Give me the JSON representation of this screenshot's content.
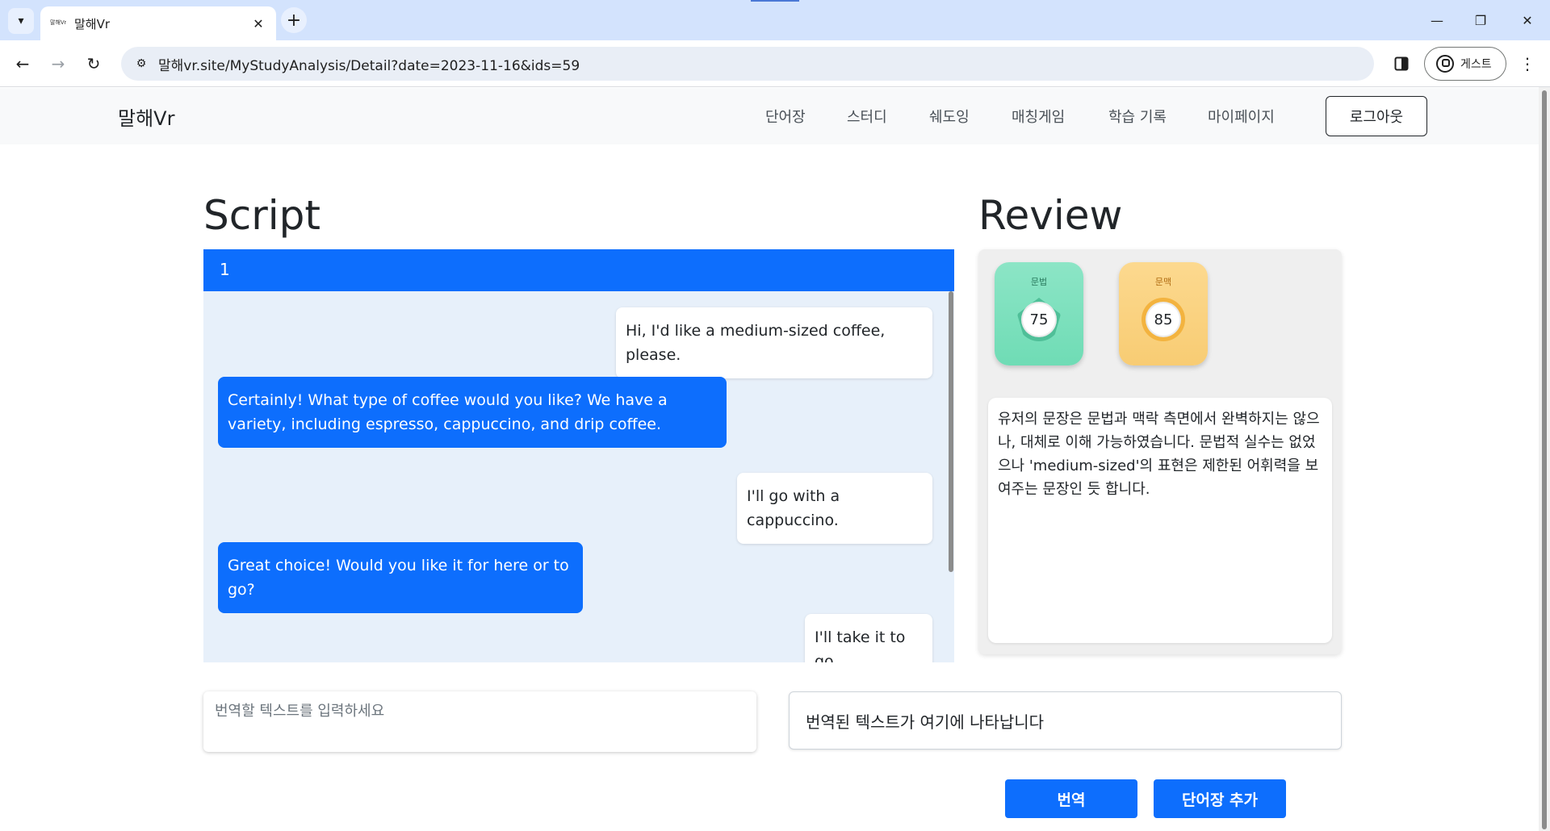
{
  "browser": {
    "tab_title": "말해Vr",
    "favicon_text": "말해Vr",
    "url": "말해vr.site/MyStudyAnalysis/Detail?date=2023-11-16&ids=59",
    "profile_label": "게스트"
  },
  "navbar": {
    "brand": "말해Vr",
    "links": [
      "단어장",
      "스터디",
      "쉐도잉",
      "매칭게임",
      "학습 기록",
      "마이페이지"
    ],
    "logout": "로그아웃"
  },
  "script": {
    "title": "Script",
    "header": "1",
    "messages": [
      {
        "role": "user",
        "text": "Hi, I'd like a medium-sized coffee, please."
      },
      {
        "role": "bot",
        "text": "Certainly! What type of coffee would you like? We have a variety, including espresso, cappuccino, and drip coffee."
      },
      {
        "role": "user",
        "text": "I'll go with a cappuccino."
      },
      {
        "role": "bot",
        "text": "Great choice! Would you like it for here or to go?"
      },
      {
        "role": "user",
        "text": "I'll take it to go."
      }
    ]
  },
  "review": {
    "title": "Review",
    "grammar": {
      "label": "문법",
      "score": "75"
    },
    "context": {
      "label": "문맥",
      "score": "85"
    },
    "feedback": "유저의 문장은 문법과 맥락 측면에서 완벽하지는 않으나, 대체로 이해 가능하였습니다. 문법적 실수는 없었으나 'medium-sized'의 표현은 제한된 어휘력을 보여주는 문장인 듯 합니다."
  },
  "translation": {
    "input_placeholder": "번역할 텍스트를 입력하세요",
    "input_value": "",
    "output": "번역된 텍스트가 여기에 나타납니다",
    "translate_button": "번역",
    "add_vocab_button": "단어장 추가"
  },
  "colors": {
    "primary": "#0d6efd",
    "chat_bg": "#e7f0fa",
    "grammar_badge": "#7fe0bf",
    "context_badge": "#fad382"
  }
}
